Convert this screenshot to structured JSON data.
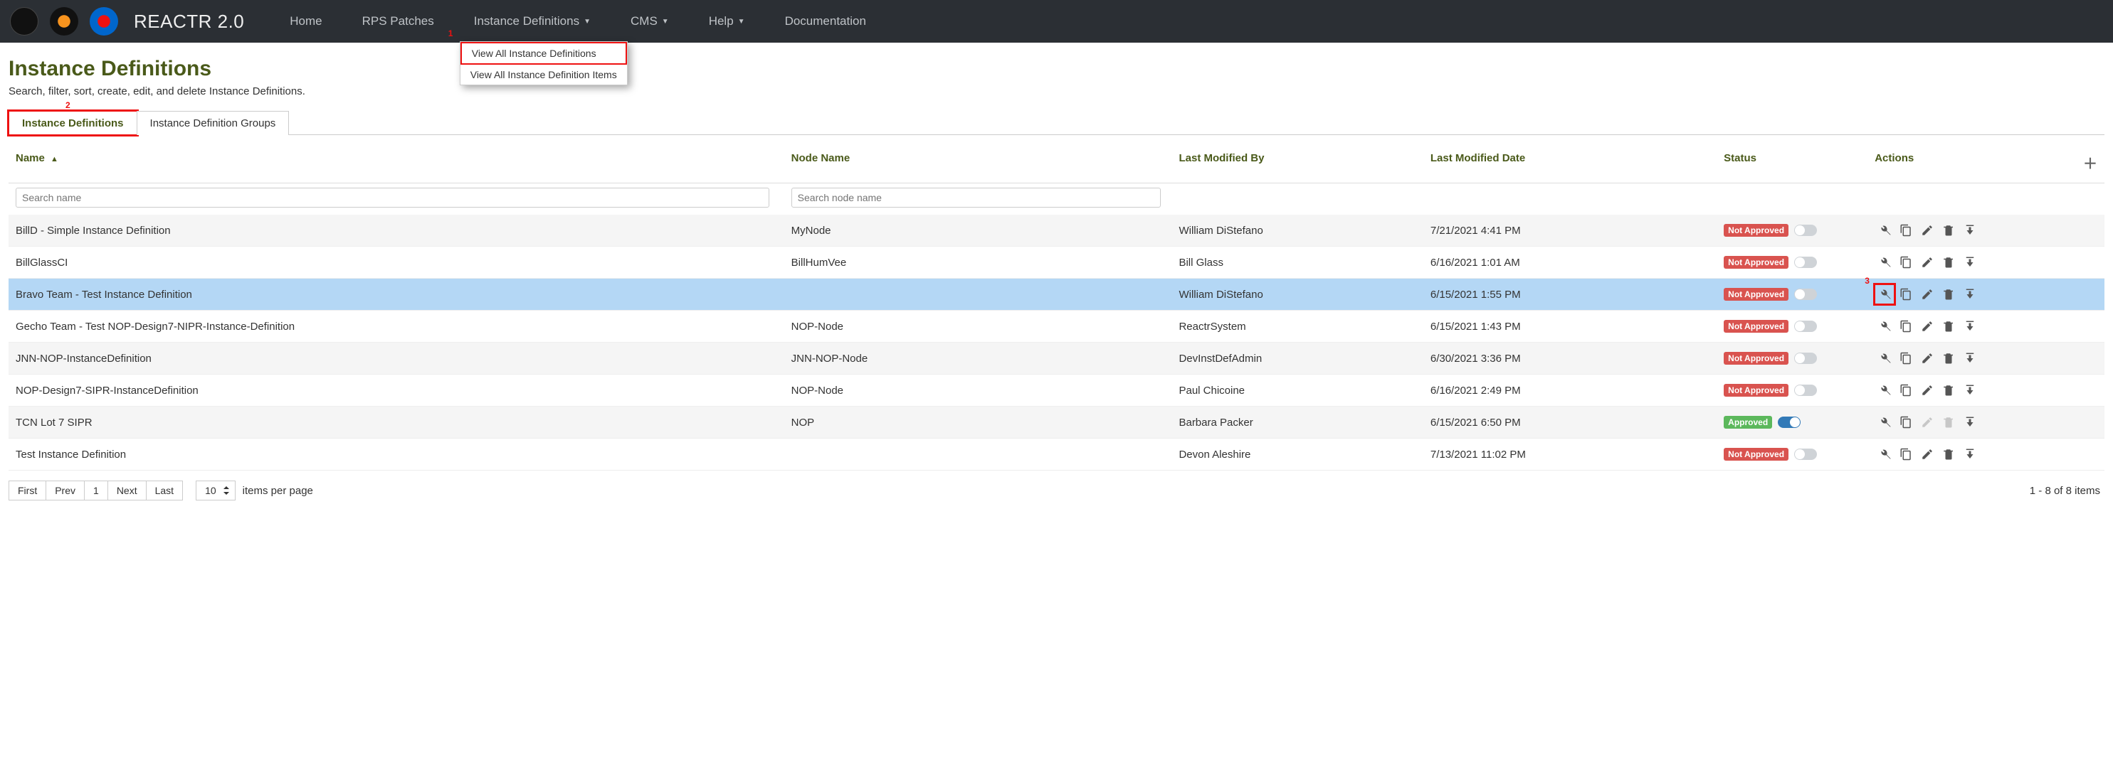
{
  "brand": "REACTR 2.0",
  "nav": {
    "home": "Home",
    "rps": "RPS Patches",
    "inst": "Instance Definitions",
    "cms": "CMS",
    "help": "Help",
    "doc": "Documentation"
  },
  "dropdown": {
    "view_all": "View All Instance Definitions",
    "view_items": "View All Instance Definition Items"
  },
  "page": {
    "title": "Instance Definitions",
    "subtitle": "Search, filter, sort, create, edit, and delete Instance Definitions."
  },
  "tabs": {
    "defs": "Instance Definitions",
    "groups": "Instance Definition Groups"
  },
  "columns": {
    "name": "Name",
    "node": "Node Name",
    "modby": "Last Modified By",
    "moddt": "Last Modified Date",
    "status": "Status",
    "actions": "Actions"
  },
  "filters": {
    "name_ph": "Search name",
    "node_ph": "Search node name"
  },
  "status_labels": {
    "na": "Not Approved",
    "ok": "Approved"
  },
  "rows": [
    {
      "name": "BillD - Simple Instance Definition",
      "node": "MyNode",
      "modby": "William DiStefano",
      "moddt": "7/21/2021 4:41 PM",
      "status": "na",
      "sel": false,
      "edit": true,
      "del": true
    },
    {
      "name": "BillGlassCI",
      "node": "BillHumVee",
      "modby": "Bill Glass",
      "moddt": "6/16/2021 1:01 AM",
      "status": "na",
      "sel": false,
      "edit": true,
      "del": true
    },
    {
      "name": "Bravo Team - Test Instance Definition",
      "node": "",
      "modby": "William DiStefano",
      "moddt": "6/15/2021 1:55 PM",
      "status": "na",
      "sel": true,
      "edit": true,
      "del": true,
      "wrench_hl": true
    },
    {
      "name": "Gecho Team - Test NOP-Design7-NIPR-Instance-Definition",
      "node": "NOP-Node",
      "modby": "ReactrSystem",
      "moddt": "6/15/2021 1:43 PM",
      "status": "na",
      "sel": false,
      "edit": true,
      "del": true
    },
    {
      "name": "JNN-NOP-InstanceDefinition",
      "node": "JNN-NOP-Node",
      "modby": "DevInstDefAdmin",
      "moddt": "6/30/2021 3:36 PM",
      "status": "na",
      "sel": false,
      "edit": true,
      "del": true
    },
    {
      "name": "NOP-Design7-SIPR-InstanceDefinition",
      "node": "NOP-Node",
      "modby": "Paul Chicoine",
      "moddt": "6/16/2021 2:49 PM",
      "status": "na",
      "sel": false,
      "edit": true,
      "del": true
    },
    {
      "name": "TCN Lot 7 SIPR",
      "node": "NOP",
      "modby": "Barbara Packer",
      "moddt": "6/15/2021 6:50 PM",
      "status": "ok",
      "sel": false,
      "edit": false,
      "del": false
    },
    {
      "name": "Test Instance Definition",
      "node": "",
      "modby": "Devon Aleshire",
      "moddt": "7/13/2021 11:02 PM",
      "status": "na",
      "sel": false,
      "edit": true,
      "del": true
    }
  ],
  "pager": {
    "first": "First",
    "prev": "Prev",
    "page": "1",
    "next": "Next",
    "last": "Last",
    "size": "10",
    "ipp": "items per page",
    "count": "1 - 8 of 8 items"
  },
  "callouts": {
    "c1": "1",
    "c2": "2",
    "c3": "3"
  }
}
